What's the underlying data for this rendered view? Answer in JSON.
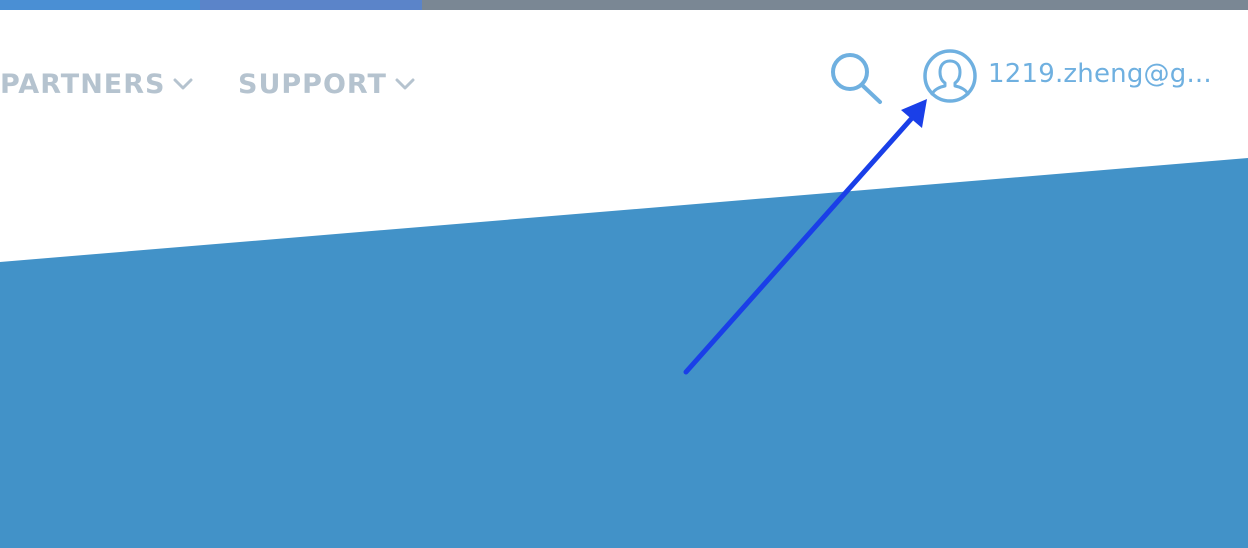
{
  "colors": {
    "strip_segment_1": "#4a8fd4",
    "strip_segment_2": "#5b84c9",
    "strip_segment_3": "#7a8794",
    "nav_text": "#b5c3cf",
    "accent_light_blue": "#6fb0e0",
    "hero_blue": "#4292c8",
    "arrow_blue": "#1a3fe8",
    "background": "#ffffff"
  },
  "nav": {
    "items": [
      {
        "label": "PARTNERS",
        "icon": "chevron-down-icon"
      },
      {
        "label": "SUPPORT",
        "icon": "chevron-down-icon"
      }
    ]
  },
  "header": {
    "search_icon": "search-icon",
    "account": {
      "icon": "user-avatar-icon",
      "label": "1219.zheng@g..."
    }
  },
  "annotation": {
    "icon": "arrow-pointer-icon"
  }
}
